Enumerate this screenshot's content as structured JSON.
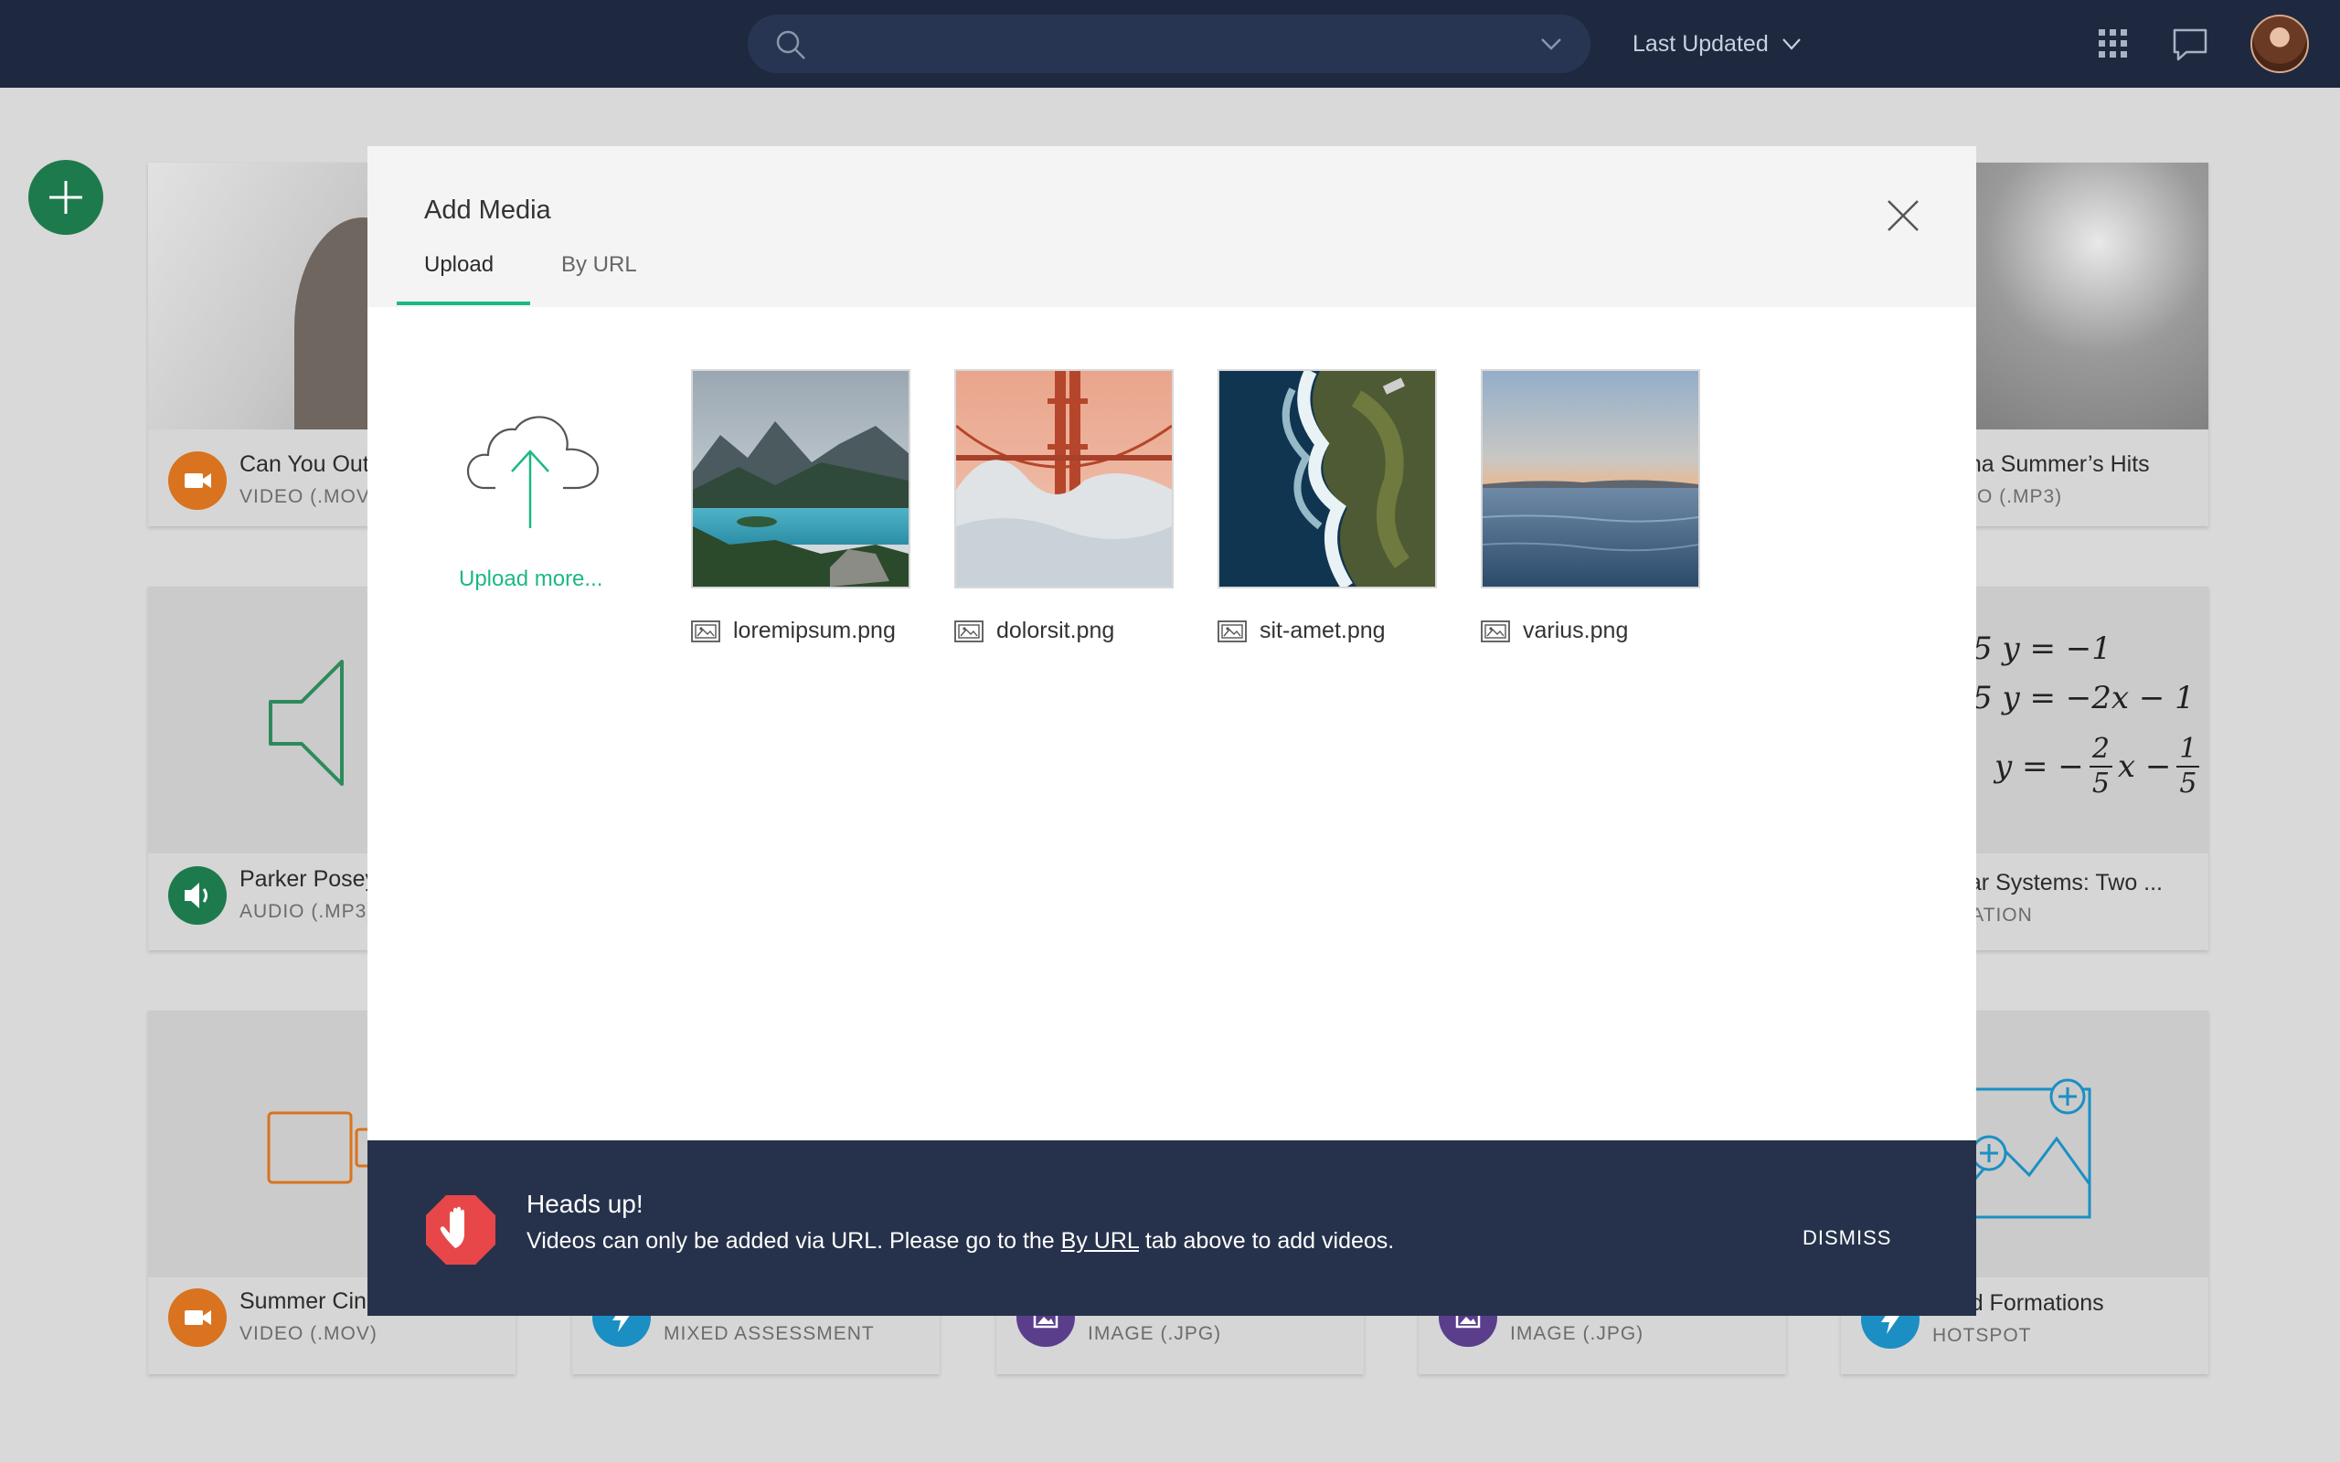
{
  "topbar": {
    "search": {
      "placeholder": ""
    },
    "sort_label": "Last Updated"
  },
  "cards": [
    {
      "title": "Can You Out",
      "subtitle": "VIDEO (.MOV)",
      "badge_color": "#d9731f",
      "icon": "video-camera-icon"
    },
    {
      "title": "nna Summer’s Hits",
      "subtitle": "DIO (.MP3)",
      "badge_color": "#1d7a4c",
      "icon": "speaker-icon"
    },
    {
      "title": "Parker Posey",
      "subtitle": "AUDIO (.MP3)",
      "badge_color": "#1d7a4c",
      "icon": "speaker-icon"
    },
    {
      "title": "ear Systems: Two ...",
      "subtitle": "UATION",
      "badge_color": "#1b6fb3",
      "icon": "equation-icon"
    },
    {
      "title": "Summer Cin",
      "subtitle": "VIDEO (.MOV)",
      "badge_color": "#d9731f",
      "icon": "video-camera-icon"
    },
    {
      "title": "",
      "subtitle": "MIXED ASSESSMENT",
      "badge_color": "#1b8fc4",
      "icon": "bolt-icon"
    },
    {
      "title": "",
      "subtitle": "IMAGE (.JPG)",
      "badge_color": "#5a3e8c",
      "icon": "image-icon"
    },
    {
      "title": "",
      "subtitle": "IMAGE (.JPG)",
      "badge_color": "#5a3e8c",
      "icon": "image-icon"
    },
    {
      "title": "Land Formations",
      "subtitle": "HOTSPOT",
      "badge_color": "#1b8fc4",
      "icon": "bolt-icon"
    }
  ],
  "equation": {
    "line1": "5 y = −1",
    "line2": "5 y = −2x − 1",
    "line3_lhs": "y = −",
    "frac1_num": "2",
    "frac1_den": "5",
    "mid": "x −",
    "frac2_num": "1",
    "frac2_den": "5"
  },
  "modal": {
    "title": "Add Media",
    "tabs": [
      {
        "label": "Upload",
        "active": true
      },
      {
        "label": "By URL",
        "active": false
      }
    ],
    "upload_more": "Upload more...",
    "files": [
      {
        "name": "loremipsum.png"
      },
      {
        "name": "dolorsit.png"
      },
      {
        "name": "sit-amet.png"
      },
      {
        "name": "varius.png"
      }
    ],
    "alert": {
      "title": "Heads up!",
      "message_before": "Videos can only be added via URL. Please go to the ",
      "message_link": "By URL",
      "message_after": " tab above to add videos.",
      "dismiss": "DISMISS"
    }
  },
  "colors": {
    "accent": "#1db884",
    "topbar": "#1e2940",
    "alert_bg": "#26324b",
    "stop_red": "#e8474a"
  }
}
